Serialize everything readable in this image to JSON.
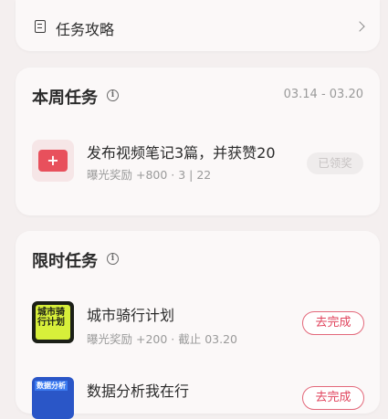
{
  "guide": {
    "label": "任务攻略"
  },
  "weekly": {
    "title": "本周任务",
    "date_range": "03.14 - 03.20",
    "task": {
      "title": "发布视频笔记3篇，并获赞20",
      "subtitle": "曝光奖励 +800 · 3 | 22",
      "button": "已领奖"
    }
  },
  "limited": {
    "title": "限时任务",
    "tasks": [
      {
        "title": "城市骑行计划",
        "subtitle": "曝光奖励 +200 · 截止 03.20",
        "button": "去完成",
        "thumb_text": "城市骑行计划"
      },
      {
        "title": "数据分析我在行",
        "button": "去完成",
        "thumb_text": "数据分析"
      }
    ]
  },
  "colors": {
    "accent": "#e0435c",
    "background": "#f4efef"
  }
}
